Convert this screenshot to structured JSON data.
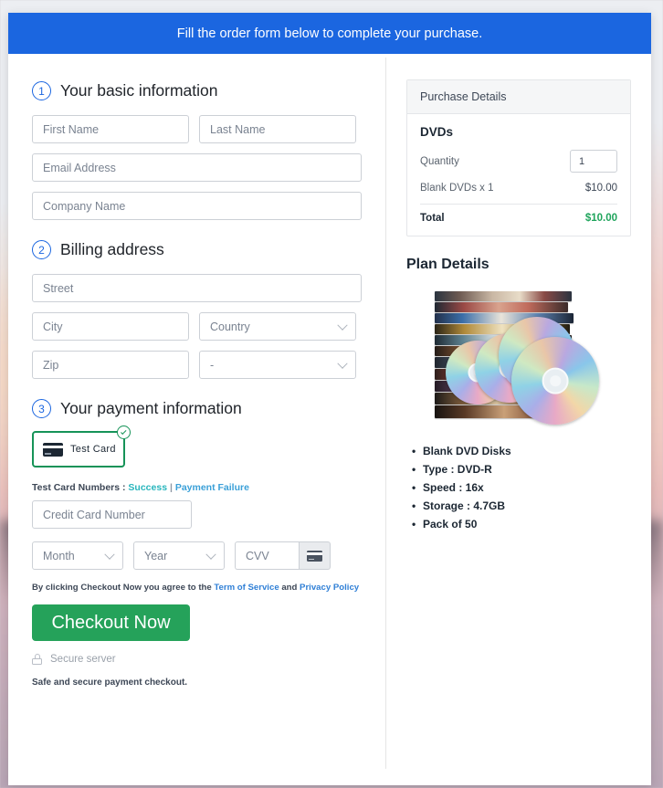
{
  "banner": {
    "text": "Fill the order form below to complete your purchase."
  },
  "sections": {
    "basic": {
      "num": "1",
      "title": "Your basic information"
    },
    "billing": {
      "num": "2",
      "title": "Billing address"
    },
    "payment": {
      "num": "3",
      "title": "Your payment information"
    }
  },
  "fields": {
    "first_name": {
      "placeholder": "First Name",
      "value": ""
    },
    "last_name": {
      "placeholder": "Last Name",
      "value": ""
    },
    "email": {
      "placeholder": "Email Address",
      "value": ""
    },
    "company": {
      "placeholder": "Company Name",
      "value": ""
    },
    "street": {
      "placeholder": "Street",
      "value": ""
    },
    "city": {
      "placeholder": "City",
      "value": ""
    },
    "country": {
      "placeholder": "Country",
      "value": "Country"
    },
    "zip": {
      "placeholder": "Zip",
      "value": ""
    },
    "state": {
      "placeholder": "-",
      "value": "-"
    },
    "card_number": {
      "placeholder": "Credit Card Number",
      "value": ""
    },
    "month": {
      "placeholder": "Month",
      "value": "Month"
    },
    "year": {
      "placeholder": "Year",
      "value": "Year"
    },
    "cvv": {
      "placeholder": "CVV",
      "value": ""
    }
  },
  "payment": {
    "card_tile_label": "Test  Card",
    "test_numbers_prefix": "Test Card Numbers : ",
    "test_success_link": "Success",
    "test_separator": " | ",
    "test_failure_link": "Payment Failure",
    "terms_prefix": "By clicking Checkout Now you agree to the ",
    "terms_link_1": "Term of Service",
    "terms_middle": " and ",
    "terms_link_2": "Privacy Policy",
    "checkout_label": "Checkout Now",
    "secure_server": "Secure server",
    "safe_note": "Safe and secure payment checkout."
  },
  "purchase": {
    "header": "Purchase Details",
    "product_title": "DVDs",
    "quantity_label": "Quantity",
    "quantity_value": "1",
    "line_item_label": "Blank DVDs x 1",
    "line_item_value": "$10.00",
    "total_label": "Total",
    "total_value": "$10.00"
  },
  "plan": {
    "title": "Plan Details",
    "bullets": [
      "Blank DVD Disks",
      "Type : DVD-R",
      "Speed : 16x",
      "Storage : 4.7GB",
      "Pack of 50"
    ]
  },
  "colors": {
    "banner_blue": "#1b66e0",
    "accent_blue": "#1b66e0",
    "success_green": "#25a25a",
    "tile_green": "#169358",
    "total_green": "#1fa45c",
    "link_teal": "#29b6bd",
    "link_blue": "#2f7fd6"
  }
}
